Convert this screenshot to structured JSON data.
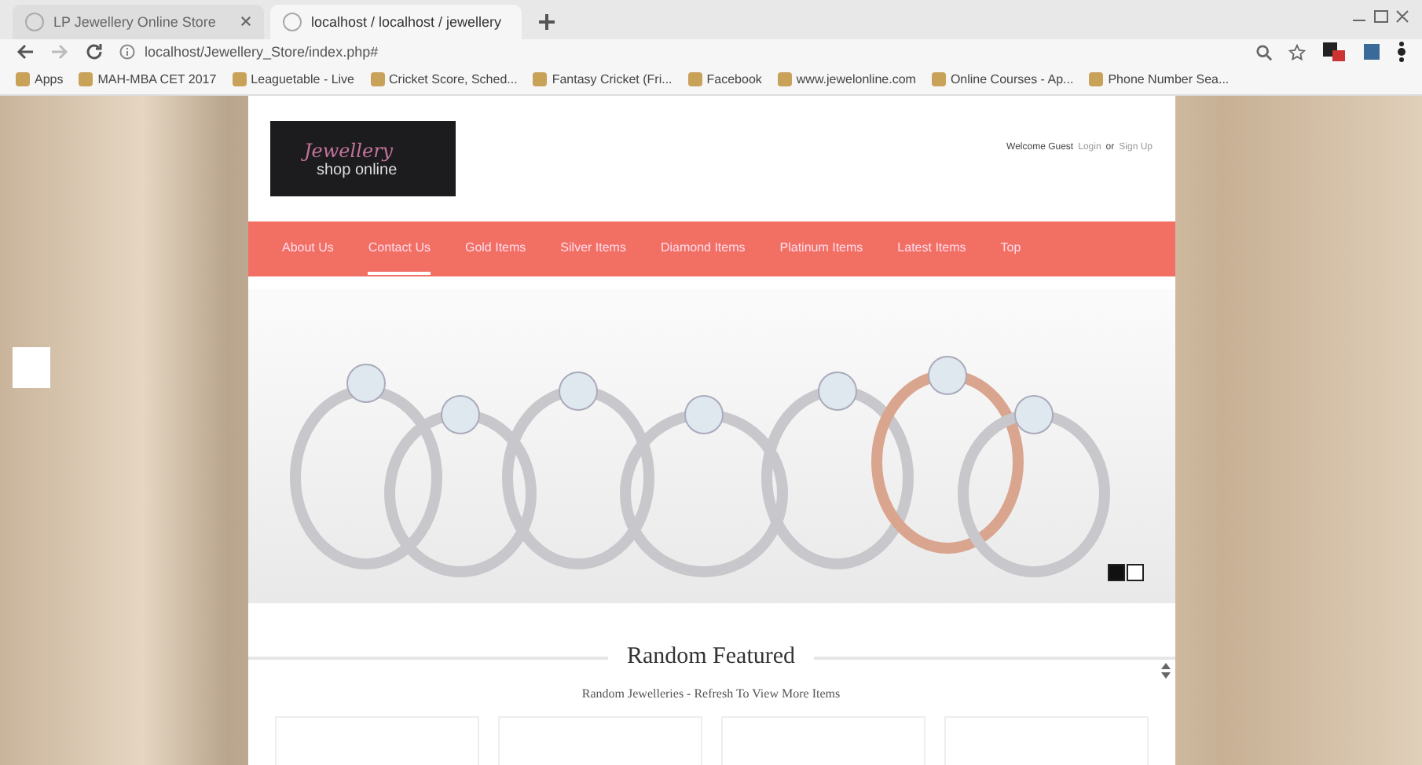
{
  "browser": {
    "tabs": [
      {
        "title": "LP Jewellery Online Store",
        "selected": false
      },
      {
        "title": "localhost / localhost / jewellery",
        "selected": true
      }
    ],
    "address": "localhost/Jewellery_Store/index.php#",
    "bookmarks": [
      "Apps",
      "MAH-MBA CET 2017",
      "Leaguetable - Live",
      "Cricket Score, Sched...",
      "Fantasy Cricket (Fri...",
      "Facebook",
      "www.jewelonline.com",
      "Online Courses - Ap...",
      "Phone Number Sea..."
    ]
  },
  "header": {
    "logo_line_1": "Jewellery",
    "logo_line_2": "shop online",
    "welcome": "Welcome Guest",
    "login": "Login",
    "or": "or",
    "signup": "Sign Up"
  },
  "nav": [
    {
      "label": "About Us",
      "selected": false
    },
    {
      "label": "Contact Us",
      "selected": true
    },
    {
      "label": "Gold Items",
      "selected": false
    },
    {
      "label": "Silver Items",
      "selected": false
    },
    {
      "label": "Diamond Items",
      "selected": false
    },
    {
      "label": "Platinum Items",
      "selected": false
    },
    {
      "label": "Latest Items",
      "selected": false
    },
    {
      "label": "Top",
      "selected": false
    }
  ],
  "slider": {
    "dots": [
      {
        "selected": true
      },
      {
        "selected": false
      }
    ]
  },
  "featured": {
    "title": "Random Featured",
    "subtitle": "Random Jewelleries - Refresh To View More Items"
  }
}
